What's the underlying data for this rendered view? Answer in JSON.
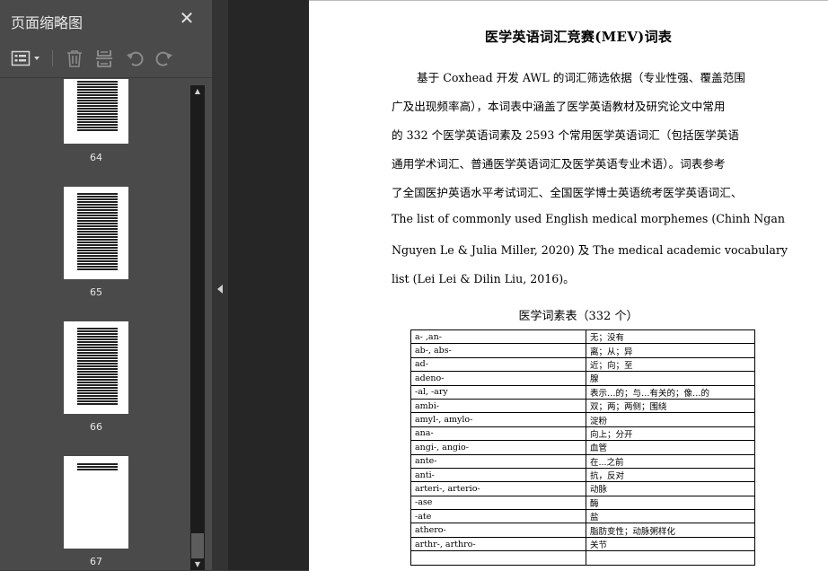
{
  "sidebar": {
    "title": "页面缩略图",
    "close_glyph": "✕",
    "toolbar": {
      "icons": [
        "thumbnail-options-icon",
        "dropdown-caret-icon",
        "delete-page-icon",
        "extract-page-icon",
        "rotate-left-icon",
        "rotate-right-icon"
      ]
    },
    "thumbnails": [
      {
        "label": "64"
      },
      {
        "label": "65"
      },
      {
        "label": "66"
      },
      {
        "label": "67"
      }
    ],
    "scroll_up_glyph": "▲",
    "scroll_down_glyph": "▼"
  },
  "document": {
    "title": "医学英语词汇竞赛(MEV)词表",
    "paragraph_lines": [
      "基于 Coxhead  开发 AWL 的词汇筛选依据（专业性强、覆盖范围",
      "广及出现频率高），本词表中涵盖了医学英语教材及研究论文中常用",
      "的 332 个医学英语词素及 2593 个常用医学英语词汇（包括医学英语",
      "通用学术词汇、普通医学英语词汇及医学英语专业术语）。词表参考",
      "了全国医护英语水平考试词汇、全国医学博士英语统考医学英语词汇、",
      "The list of commonly used English medical morphemes (Chinh Ngan",
      "Nguyen Le & Julia Miller, 2020)  及 The medical academic vocabulary",
      "list (Lei Lei & Dilin Liu, 2016)。"
    ],
    "table_title": "医学词素表（332 个）",
    "table_rows": [
      [
        "a- ,an-",
        "无；没有"
      ],
      [
        "ab-, abs-",
        "离；从；异"
      ],
      [
        "ad-",
        "近；向；至"
      ],
      [
        "adeno-",
        "腺"
      ],
      [
        "-al, -ary",
        "表示…的；与…有关的；像…的"
      ],
      [
        "ambi-",
        "双；两；两侧；围绕"
      ],
      [
        "amyl-, amylo-",
        "淀粉"
      ],
      [
        "ana-",
        "向上；分开"
      ],
      [
        "angi-, angio-",
        "血管"
      ],
      [
        "ante-",
        "在...之前"
      ],
      [
        "anti-",
        "抗，反对"
      ],
      [
        "arteri-, arterio-",
        "动脉"
      ],
      [
        "-ase",
        "酶"
      ],
      [
        "-ate",
        "盐"
      ],
      [
        "athero-",
        "脂肪变性；动脉粥样化"
      ],
      [
        "arthr-, arthro-",
        "关节"
      ],
      [
        "",
        ""
      ]
    ]
  }
}
